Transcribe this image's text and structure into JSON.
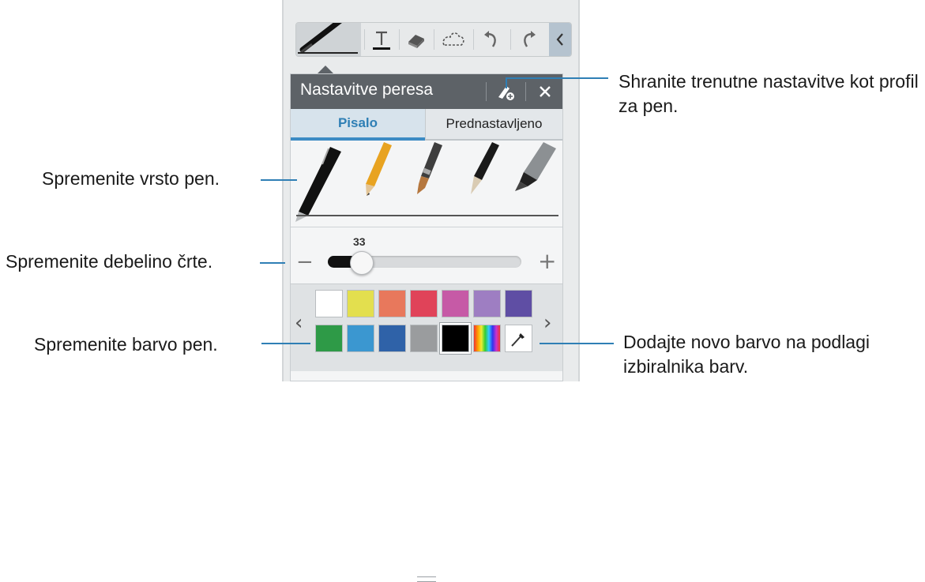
{
  "toolbar": {
    "items": [
      {
        "name": "pen-tool",
        "icon": "pen-icon"
      },
      {
        "name": "text-tool",
        "icon": "text-icon"
      },
      {
        "name": "eraser-tool",
        "icon": "eraser-icon"
      },
      {
        "name": "selection-tool",
        "icon": "lasso-selection-icon"
      },
      {
        "name": "undo",
        "icon": "undo-icon"
      },
      {
        "name": "redo",
        "icon": "redo-icon"
      },
      {
        "name": "collapse",
        "icon": "chevron-left-icon"
      }
    ]
  },
  "panel": {
    "title": "Nastavitve peresa",
    "tabs": [
      {
        "label": "Pisalo",
        "active": true
      },
      {
        "label": "Prednastavljeno",
        "active": false
      }
    ],
    "pens": [
      "ballpoint-pen-icon",
      "pencil-icon",
      "brush-icon",
      "calligraphy-brush-icon",
      "marker-icon"
    ],
    "size": {
      "value": "33",
      "fraction": 0.17
    },
    "colors": {
      "row1": [
        "#ffffff",
        "#e3df4e",
        "#e8785c",
        "#e04359",
        "#c65aa6",
        "#9e7ec2",
        "#5f4ea4"
      ],
      "row2": [
        "#2e9a47",
        "#3b97d0",
        "#2f62a8",
        "#9a9c9e",
        "#000000",
        "gradient",
        "eyedropper"
      ],
      "selected_index": 11
    }
  },
  "callouts": {
    "save_profile": "Shranite trenutne nastavitve kot profil za pen.",
    "pen_type": "Spremenite vrsto pen.",
    "thickness": "Spremenite debelino črte.",
    "color": "Spremenite barvo pen.",
    "add_color": "Dodajte novo barvo na podlagi izbiralnika barv."
  },
  "accent": "#2f7fb5"
}
